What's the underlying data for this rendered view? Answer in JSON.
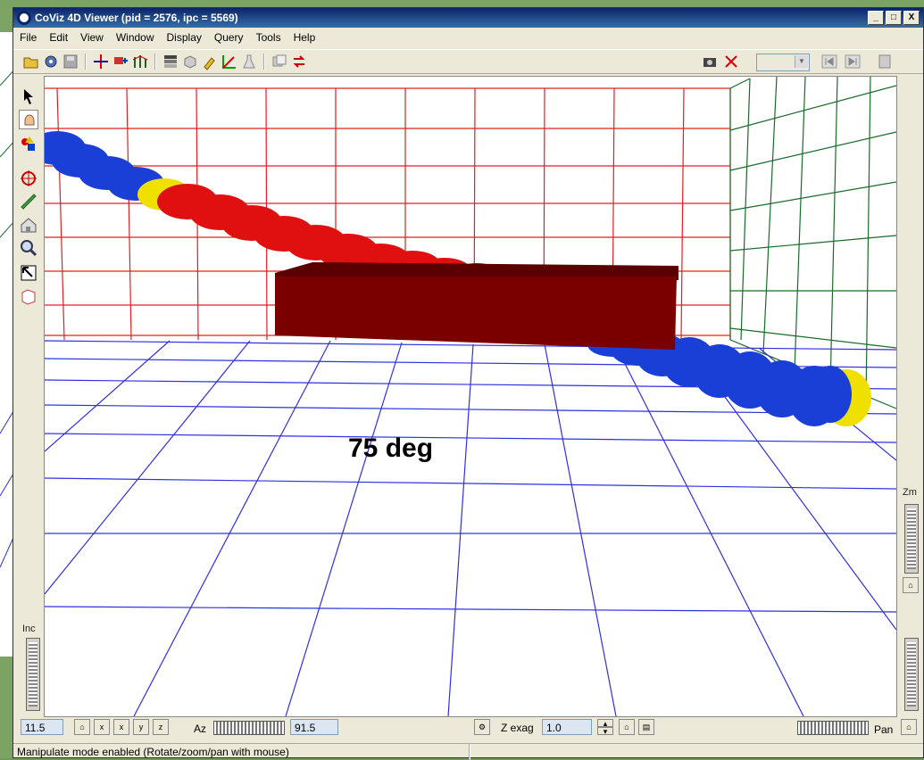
{
  "window": {
    "title": "CoViz 4D Viewer (pid = 2576, ipc = 5569)",
    "min_glyph": "_",
    "max_glyph": "□",
    "close_glyph": "X"
  },
  "menu": [
    "File",
    "Edit",
    "View",
    "Window",
    "Display",
    "Query",
    "Tools",
    "Help"
  ],
  "viewport": {
    "label": "75 deg",
    "colors": {
      "wall_grid": "#e02020",
      "side_grid": "#1a6b2a",
      "floor_grid": "#3030e0",
      "block": "#7a0000",
      "sphere_blue": "#1a3fd6",
      "sphere_red": "#e01010",
      "sphere_yellow": "#f0e000"
    }
  },
  "sliders": {
    "zoom_label": "Zm",
    "inc_label": "Inc",
    "az_label": "Az",
    "pan_label": "Pan",
    "zexag_label": "Z exag"
  },
  "fields": {
    "inc_value": "11.5",
    "az_value": "91.5",
    "zexag_value": "1.0"
  },
  "icons": {
    "bottom_x": "x",
    "bottom_y": "y",
    "bottom_z": "z",
    "spin_up": "▴",
    "spin_down": "▾"
  },
  "status": {
    "text": "Manipulate mode enabled (Rotate/zoom/pan with mouse)"
  }
}
